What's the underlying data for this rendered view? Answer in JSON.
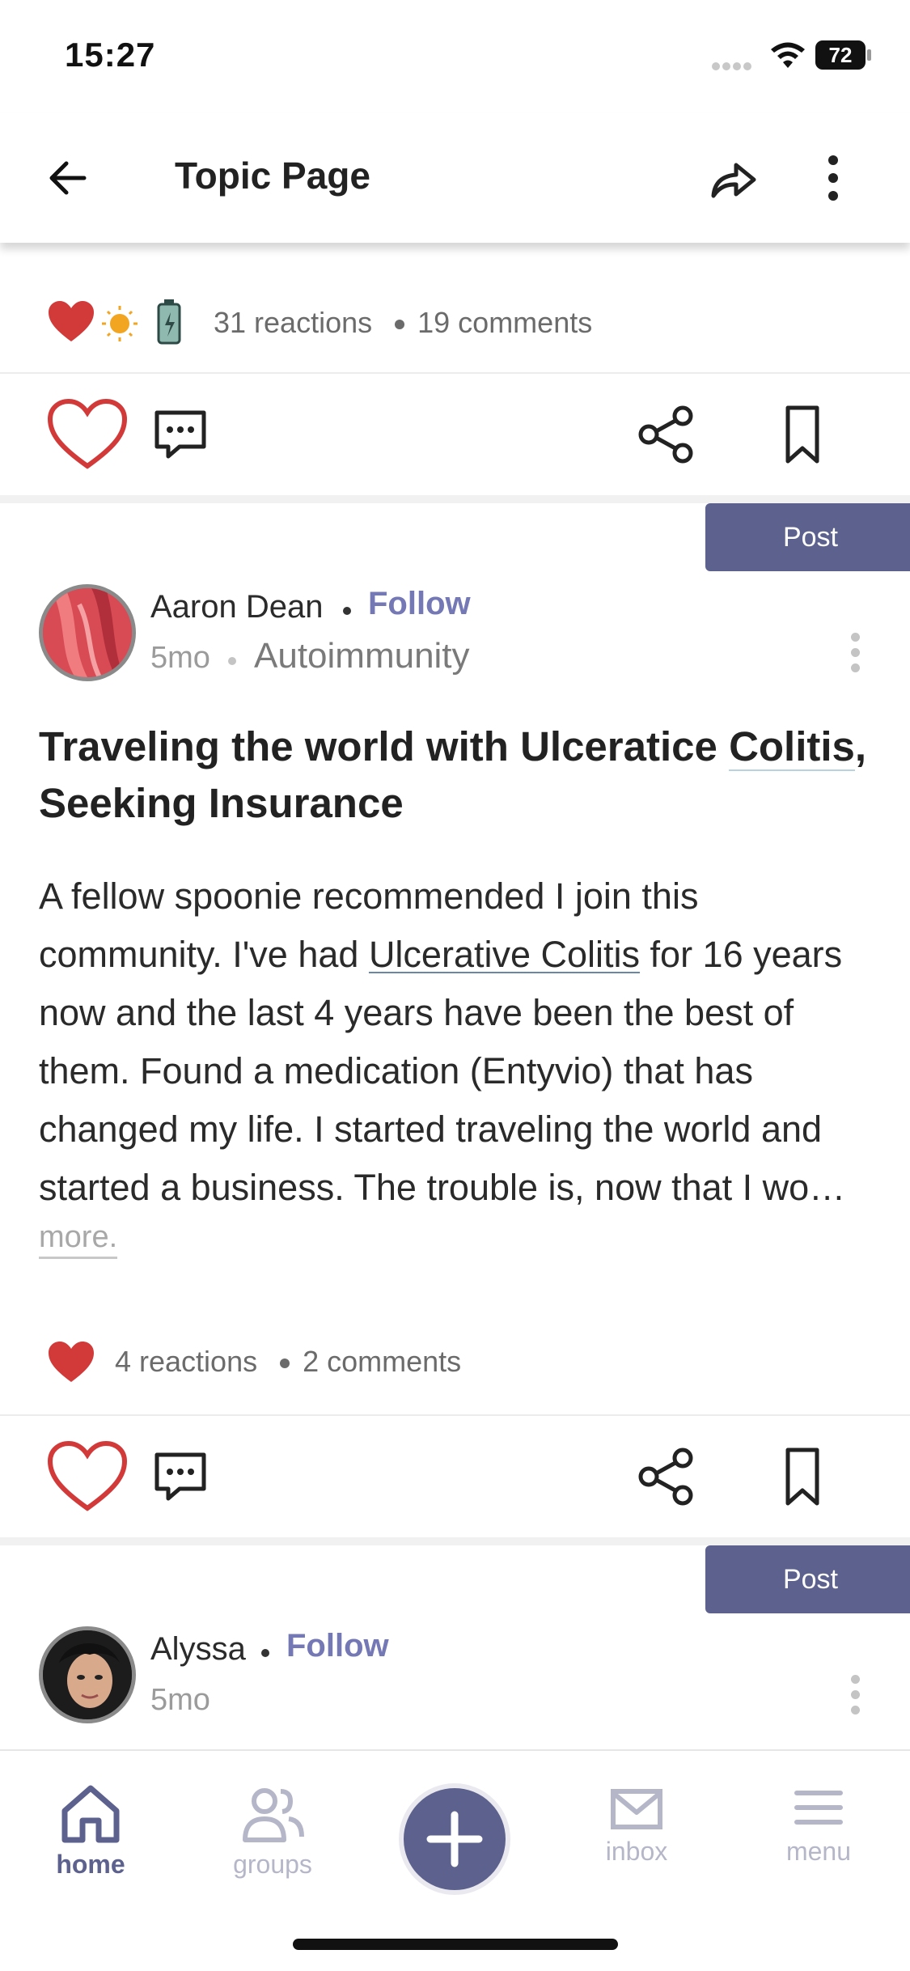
{
  "status": {
    "time": "15:27",
    "battery": "72"
  },
  "header": {
    "title": "Topic Page",
    "back_icon": "arrow-left-icon",
    "share_icon": "share-forward-icon",
    "more_icon": "more-vertical-icon"
  },
  "posts": [
    {
      "reactions": "31 reactions",
      "comments": "19 comments",
      "reaction_icons": [
        "heart-icon",
        "sun-icon",
        "battery-icon"
      ]
    },
    {
      "badge": "Post",
      "author": "Aaron Dean",
      "follow": "Follow",
      "time": "5mo",
      "topic": "Autoimmunity",
      "title_pre": "Traveling the world with Ulceratice ",
      "title_link": "Colitis",
      "title_post": ", Seeking Insurance",
      "body_pre": "A fellow spoonie recommended I join this community. I've had ",
      "body_link": "Ulcerative Colitis",
      "body_post": " for 16 years now and the last 4 years have been the best of them. Found a medication (Entyvio) that has changed my life. I started traveling the world and started a business. The trouble is, now that I wo…",
      "more": "more.",
      "reactions": "4 reactions",
      "comments": "2 comments"
    },
    {
      "badge": "Post",
      "author": "Alyssa",
      "follow": "Follow",
      "time": "5mo"
    }
  ],
  "nav": {
    "home": "home",
    "groups": "groups",
    "inbox": "inbox",
    "menu": "menu"
  },
  "colors": {
    "accent": "#5d618d",
    "follow": "#7478b4",
    "like_red": "#d23a3a",
    "nav_inactive": "#b5b7c9"
  }
}
